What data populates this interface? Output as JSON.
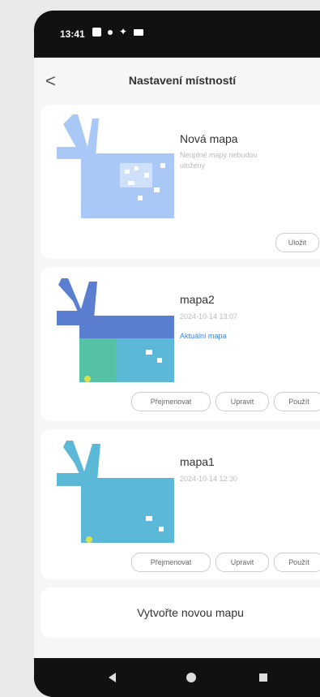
{
  "status_bar": {
    "time": "13:41"
  },
  "header": {
    "title": "Nastavení místností",
    "back": "<"
  },
  "maps": [
    {
      "name": "Nová mapa",
      "note": "Neúplné mapy nebudou uloženy",
      "buttons": [
        "Uložit"
      ]
    },
    {
      "name": "mapa2",
      "date": "2024-10-14 13:07",
      "tag": "Aktuální mapa",
      "buttons": [
        "Přejmenovat",
        "Upravit",
        "Použít"
      ]
    },
    {
      "name": "mapa1",
      "date": "2024-10-14 12:30",
      "buttons": [
        "Přejmenovat",
        "Upravit",
        "Použít"
      ]
    }
  ],
  "create_label": "Vytvořte novou mapu",
  "colors": {
    "accent": "#3a82e6",
    "map_new": "#a9c8f5",
    "map_dark_blue": "#5a7fd1",
    "map_teal": "#55c2a6",
    "map_cyan": "#5bb8d6"
  }
}
